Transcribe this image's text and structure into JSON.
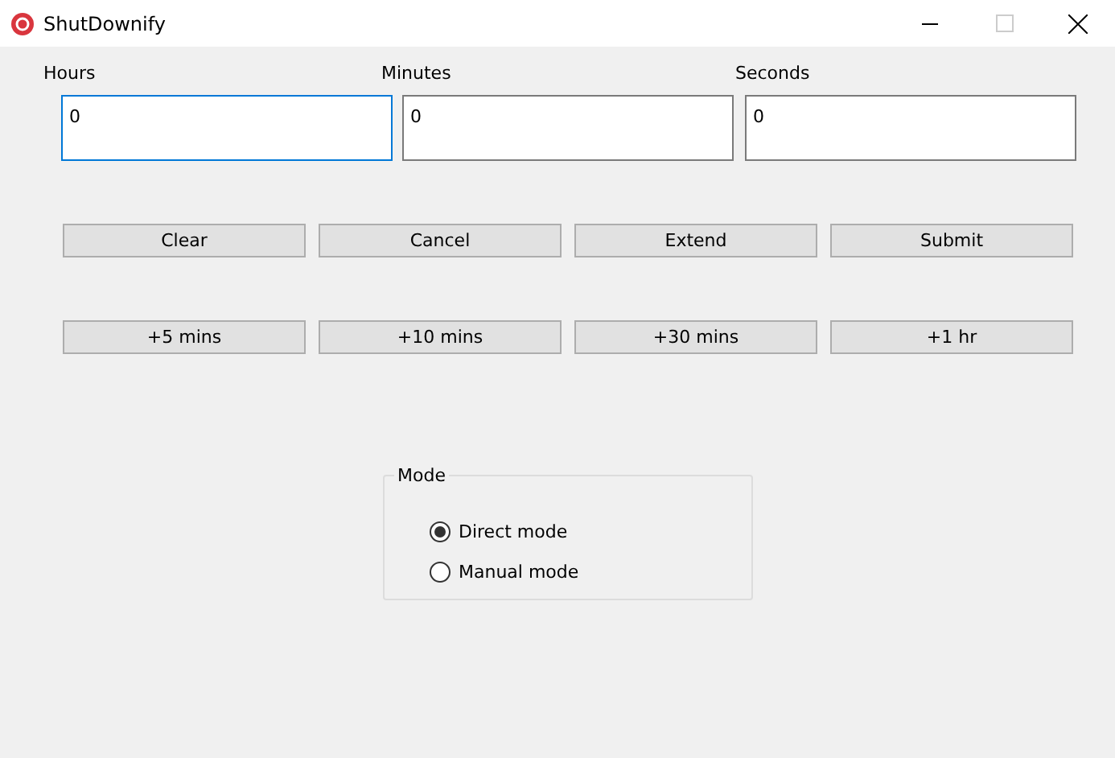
{
  "window": {
    "title": "ShutDownify"
  },
  "fields": [
    {
      "label": "Hours",
      "value": "0",
      "focused": true
    },
    {
      "label": "Minutes",
      "value": "0",
      "focused": false
    },
    {
      "label": "Seconds",
      "value": "0",
      "focused": false
    }
  ],
  "actions": [
    "Clear",
    "Cancel",
    "Extend",
    "Submit"
  ],
  "extensions": [
    "+5 mins",
    "+10 mins",
    "+30 mins",
    "+1 hr"
  ],
  "mode": {
    "title": "Mode",
    "options": [
      {
        "label": "Direct mode",
        "selected": true
      },
      {
        "label": "Manual mode",
        "selected": false
      }
    ]
  }
}
